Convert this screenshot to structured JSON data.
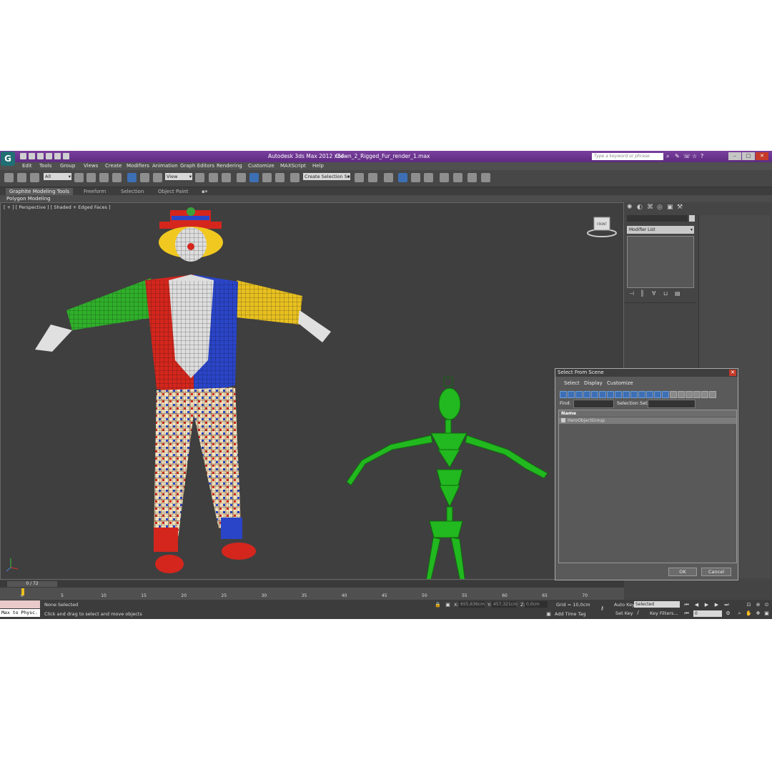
{
  "titlebar": {
    "app_title": "Autodesk 3ds Max  2012 x64",
    "file_name": "Clown_2_Rigged_Fur_render_1.max",
    "search_placeholder": "Type a keyword or phrase"
  },
  "menu": [
    "Edit",
    "Tools",
    "Group",
    "Views",
    "Create",
    "Modifiers",
    "Animation",
    "Graph Editors",
    "Rendering",
    "Customize",
    "MAXScript",
    "Help"
  ],
  "toolbar": {
    "selection_filter": "All",
    "ref_coord": "View",
    "named_selection": "Create Selection Se"
  },
  "ribbon": {
    "tabs": [
      "Graphite Modeling Tools",
      "Freeform",
      "Selection",
      "Object Paint"
    ],
    "panel": "Polygon Modeling"
  },
  "viewport": {
    "label": "[ + ] [ Perspective ] [ Shaded + Edged Faces ]",
    "viewcube_label": "FRONT"
  },
  "command_panel": {
    "modifier_list": "Modifier List"
  },
  "dialog": {
    "title": "Select From Scene",
    "menu": [
      "Select",
      "Display",
      "Customize"
    ],
    "find_label": "Find:",
    "selection_set_label": "Selection Set:",
    "column_name": "Name",
    "rows": [
      "HeroObjectGroup"
    ],
    "ok": "OK",
    "cancel": "Cancel"
  },
  "timeline": {
    "frame": "0 / 72",
    "ticks": [
      "0",
      "5",
      "10",
      "15",
      "20",
      "25",
      "30",
      "35",
      "40",
      "45",
      "50",
      "55",
      "60",
      "65",
      "70"
    ]
  },
  "status": {
    "maxscript": "Max to Physc.",
    "selection": "None Selected",
    "prompt": "Click and drag to select and move objects",
    "x": "655,636cm",
    "y": "457,321cm",
    "z": "0,0cm",
    "grid": "Grid = 10,0cm",
    "add_time_tag": "Add Time Tag",
    "auto_key": "Auto Key",
    "set_key": "Set Key",
    "key_mode": "Selected",
    "key_filters": "Key Filters...",
    "current_frame": "0"
  }
}
